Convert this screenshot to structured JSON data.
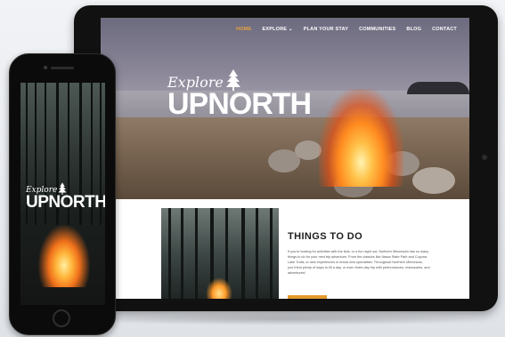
{
  "nav": {
    "items": [
      "HOME",
      "EXPLORE",
      "PLAN YOUR STAY",
      "COMMUNITIES",
      "BLOG",
      "CONTACT"
    ],
    "active_index": 0,
    "explore_dropdown": "⌄"
  },
  "hero": {
    "logo_explore": "Explore",
    "logo_brand": "UPNORTH"
  },
  "section": {
    "heading": "THINGS TO DO",
    "paragraph": "If you're looking for activities with the kids, or a fun night out, Northern Minnesota has so many things to do for your next trip adventure. From the classics like Itasca State Park and Cuyuna Lake Trails, to new experiences in brand new specialties. Throughout Northern Minnesota, you'll find plenty of ways to fill a day, or even three-day trip with performances, restaurants, and adventures!"
  },
  "phone": {
    "logo_explore": "Explore",
    "logo_brand": "UPNORTH"
  },
  "colors": {
    "accent": "#e39a2d",
    "device": "#111111"
  }
}
